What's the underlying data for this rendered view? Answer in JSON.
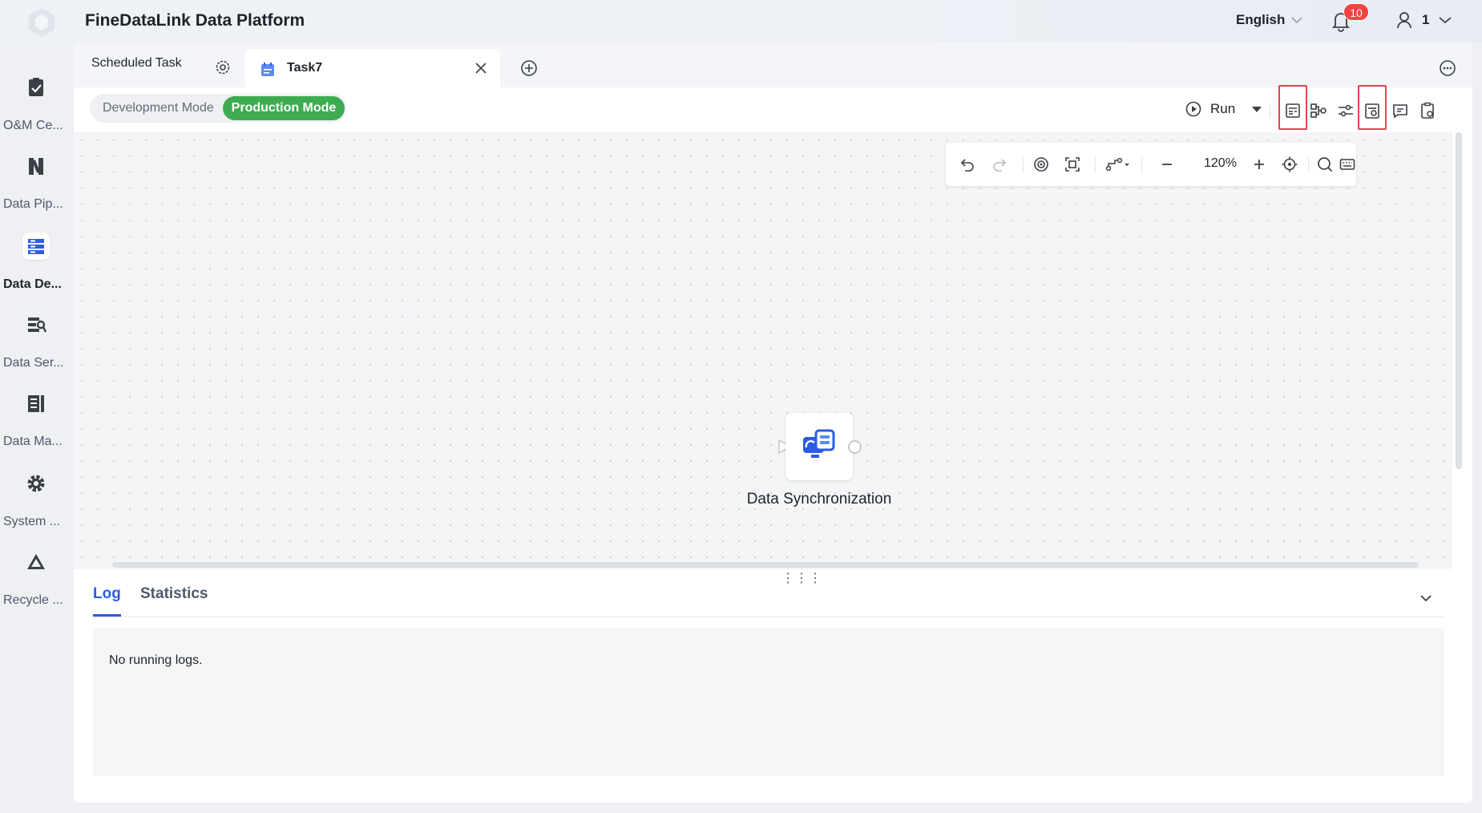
{
  "header": {
    "app_title": "FineDataLink Data Platform",
    "language": "English",
    "notification_count": "10",
    "user_name": "1"
  },
  "sidebar": {
    "items": [
      {
        "label": "O&M Ce...",
        "icon": "clipboard-check-icon",
        "active": false
      },
      {
        "label": "Data Pip...",
        "icon": "pipeline-icon",
        "active": false
      },
      {
        "label": "Data De...",
        "icon": "data-development-icon",
        "active": true
      },
      {
        "label": "Data Ser...",
        "icon": "data-service-icon",
        "active": false
      },
      {
        "label": "Data Ma...",
        "icon": "data-map-icon",
        "active": false
      },
      {
        "label": "System ...",
        "icon": "gear-icon",
        "active": false
      },
      {
        "label": "Recycle ...",
        "icon": "recycle-icon",
        "active": false
      }
    ]
  },
  "tabs": {
    "scheduled_label": "Scheduled Task",
    "active_label": "Task7"
  },
  "toolbar": {
    "mode_dev": "Development Mode",
    "mode_prod": "Production Mode",
    "run_label": "Run"
  },
  "canvas": {
    "zoom": "120%",
    "node_label": "Data Synchronization"
  },
  "log": {
    "tab_log": "Log",
    "tab_statistics": "Statistics",
    "empty_text": "No running logs."
  },
  "colors": {
    "accent_blue": "#2c5ce6",
    "prod_green": "#3dac50",
    "badge_red": "#f0453f",
    "highlight_red": "#e04451"
  }
}
